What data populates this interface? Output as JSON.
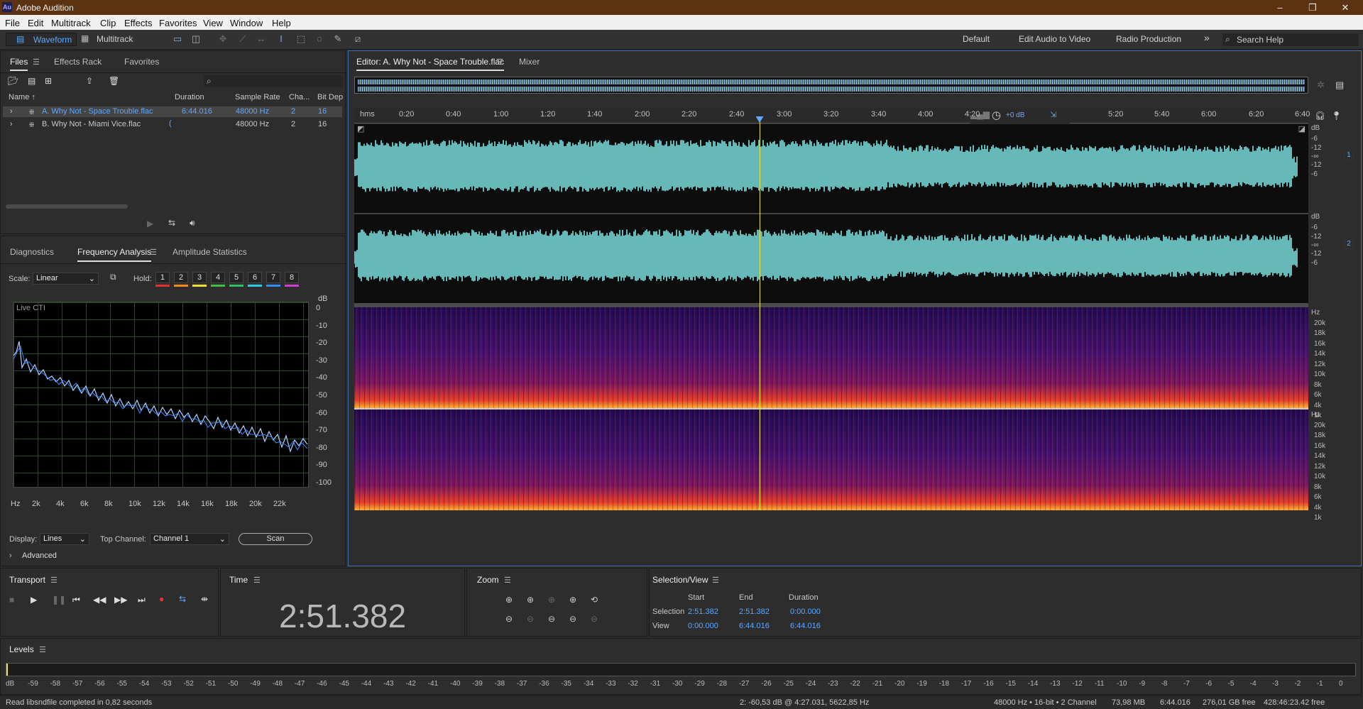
{
  "app": {
    "title": "Adobe Audition",
    "logo": "Au"
  },
  "window_controls": {
    "minimize": "–",
    "maximize": "❐",
    "close": "✕"
  },
  "menu": [
    "File",
    "Edit",
    "Multitrack",
    "Clip",
    "Effects",
    "Favorites",
    "View",
    "Window",
    "Help"
  ],
  "toolbar": {
    "waveform_label": "Waveform",
    "multitrack_label": "Multitrack",
    "workspaces": [
      "Default",
      "Edit Audio to Video",
      "Radio Production"
    ],
    "more": "»",
    "search_placeholder": "Search Help"
  },
  "files_panel": {
    "tabs": [
      "Files",
      "Effects Rack",
      "Favorites"
    ],
    "columns": [
      "Name ↑",
      "Duration",
      "Sample Rate",
      "Cha...",
      "Bit Dep"
    ],
    "rows": [
      {
        "name": "A. Why Not - Space Trouble.flac",
        "duration": "6:44.016",
        "rate": "48000 Hz",
        "ch": "2",
        "bit": "16"
      },
      {
        "name": "B. Why Not - Miami Vice.flac",
        "duration": "",
        "rate": "48000 Hz",
        "ch": "2",
        "bit": "16"
      }
    ]
  },
  "analysis_panel": {
    "tabs": [
      "Diagnostics",
      "Frequency Analysis",
      "Amplitude Statistics"
    ],
    "scale_label": "Scale:",
    "scale_value": "Linear",
    "hold_label": "Hold:",
    "hold_buttons": [
      "1",
      "2",
      "3",
      "4",
      "5",
      "6",
      "7",
      "8"
    ],
    "hold_colors": [
      "#e83030",
      "#f08a20",
      "#f0e030",
      "#40c040",
      "#30c060",
      "#30c8e0",
      "#3090f0",
      "#d040d0"
    ],
    "live_label": "Live CTI",
    "db_ticks": [
      "dB",
      "0",
      "-10",
      "-20",
      "-30",
      "-40",
      "-50",
      "-60",
      "-70",
      "-80",
      "-90",
      "-100"
    ],
    "freq_ticks": [
      "Hz",
      "2k",
      "4k",
      "6k",
      "8k",
      "10k",
      "12k",
      "14k",
      "16k",
      "18k",
      "20k",
      "22k"
    ],
    "display_label": "Display:",
    "display_value": "Lines",
    "top_channel_label": "Top Channel:",
    "top_channel_value": "Channel 1",
    "scan": "Scan",
    "advanced": "Advanced"
  },
  "editor": {
    "tabs": [
      "Editor: A. Why Not - Space Trouble.flac",
      "Mixer"
    ],
    "time_ticks": [
      "hms",
      "0:20",
      "0:40",
      "1:00",
      "1:20",
      "1:40",
      "2:00",
      "2:20",
      "2:40",
      "3:00",
      "3:20",
      "3:40",
      "4:00",
      "4:20",
      "5:20",
      "5:40",
      "6:00",
      "6:20",
      "6:40"
    ],
    "volume": "+0 dB",
    "wave_db": [
      "dB",
      "-6",
      "-12",
      "-∞",
      "-12",
      "-6"
    ],
    "channels": [
      "1",
      "2"
    ],
    "spec_hz": [
      "Hz",
      "20k",
      "18k",
      "16k",
      "14k",
      "12k",
      "10k",
      "8k",
      "6k",
      "4k",
      "1k"
    ],
    "playhead_fraction": 0.4245
  },
  "transport": {
    "title": "Transport",
    "buttons": [
      "stop",
      "play",
      "pause",
      "move-to-previous",
      "rewind",
      "fast-forward",
      "move-to-next",
      "record",
      "loop",
      "skip-selection"
    ]
  },
  "time_panel": {
    "title": "Time",
    "value": "2:51.382"
  },
  "zoom_panel": {
    "title": "Zoom"
  },
  "selection_panel": {
    "title": "Selection/View",
    "headers": [
      "Start",
      "End",
      "Duration"
    ],
    "rows": [
      {
        "label": "Selection",
        "start": "2:51.382",
        "end": "2:51.382",
        "duration": "0:00.000"
      },
      {
        "label": "View",
        "start": "0:00.000",
        "end": "6:44.016",
        "duration": "6:44.016"
      }
    ]
  },
  "levels": {
    "title": "Levels",
    "ticks": [
      "dB",
      "-59",
      "-58",
      "-57",
      "-56",
      "-55",
      "-54",
      "-53",
      "-52",
      "-51",
      "-50",
      "-49",
      "-48",
      "-47",
      "-46",
      "-45",
      "-44",
      "-43",
      "-42",
      "-41",
      "-40",
      "-39",
      "-38",
      "-37",
      "-36",
      "-35",
      "-34",
      "-33",
      "-32",
      "-31",
      "-30",
      "-29",
      "-28",
      "-27",
      "-26",
      "-25",
      "-24",
      "-23",
      "-22",
      "-21",
      "-20",
      "-19",
      "-18",
      "-17",
      "-16",
      "-15",
      "-14",
      "-13",
      "-12",
      "-11",
      "-10",
      "-9",
      "-8",
      "-7",
      "-6",
      "-5",
      "-4",
      "-3",
      "-2",
      "-1",
      "0"
    ]
  },
  "status": {
    "message": "Read libsndfile completed in 0,82 seconds",
    "cursor": "2: -60,53 dB @ 4:27.031, 5622,85 Hz",
    "format": "48000 Hz • 16-bit • 2 Channel",
    "size": "73,98 MB",
    "duration": "6:44.016",
    "free": "276,01 GB free",
    "free_time": "428:46:23.42 free"
  },
  "colors": {
    "waveform": "#7ee3e3",
    "accent": "#5ea8ff",
    "playhead": "#e8e840",
    "titlebar": "#5b3311"
  }
}
